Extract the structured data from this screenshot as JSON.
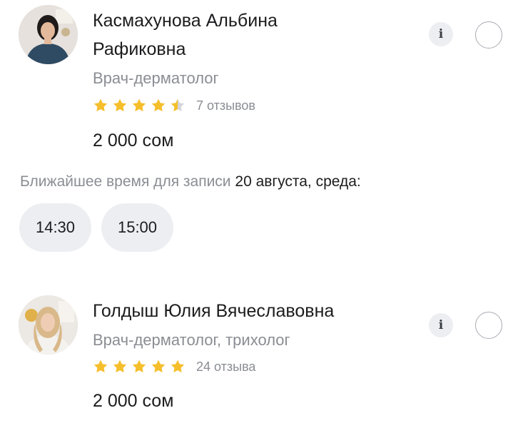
{
  "doctors": [
    {
      "name_line1": "Касмахунова Альбина",
      "name_line2": "Рафиковна",
      "specialty": "Врач-дерматолог",
      "rating": 4.5,
      "reviews": "7 отзывов",
      "price": "2 000 сом",
      "info_icon": "i"
    },
    {
      "name_line1": "Голдыш Юлия Вячеславовна",
      "specialty": "Врач-дерматолог, трихолог",
      "rating": 5,
      "reviews": "24 отзыва",
      "price": "2 000 сом",
      "info_icon": "i"
    }
  ],
  "booking": {
    "label": "Ближайшее время для записи",
    "date": "20 августа, среда:",
    "slots": [
      "14:30",
      "15:00"
    ]
  },
  "colors": {
    "star_filled": "#F5BE2B",
    "star_empty": "#D3D5DA",
    "muted_text": "#8A8D93",
    "chip_bg": "#ECEEF2"
  },
  "icons": {
    "info": "info-icon",
    "radio": "radio-unchecked-icon",
    "star": "star-icon"
  }
}
